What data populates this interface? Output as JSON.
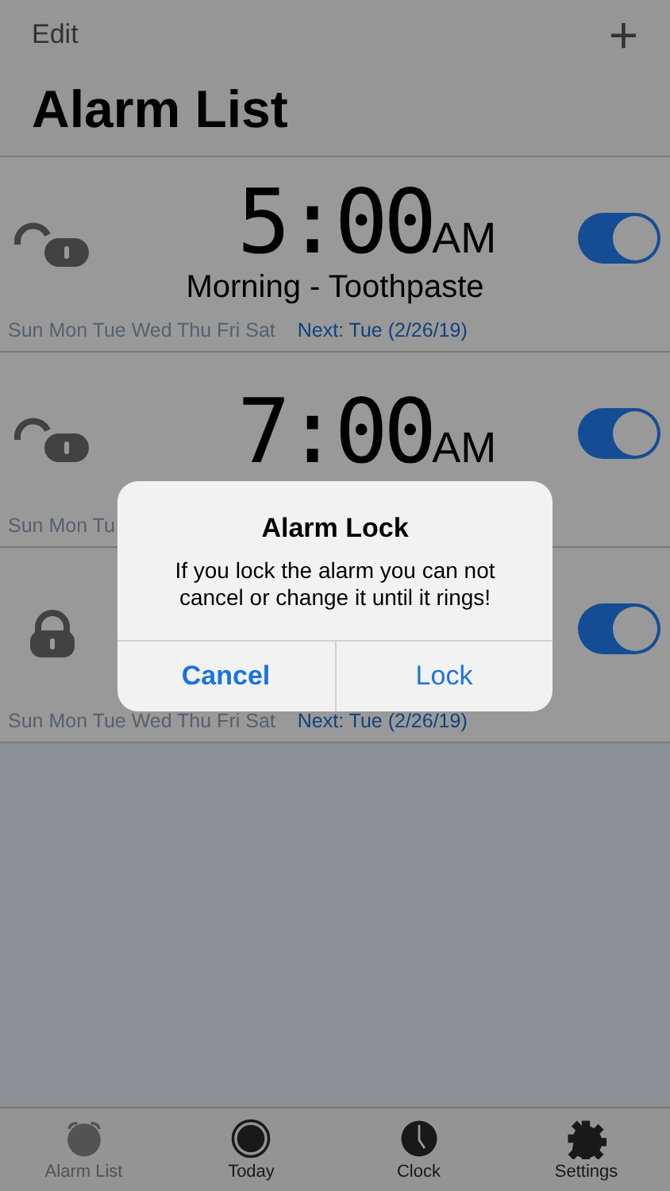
{
  "nav": {
    "edit": "Edit",
    "add": "+"
  },
  "title": "Alarm List",
  "alarms": [
    {
      "time": "5:00",
      "meridiem": "AM",
      "label": "Morning - Toothpaste",
      "days": "Sun Mon Tue Wed Thu Fri Sat",
      "next": "Next: Tue (2/26/19)",
      "locked": false,
      "on": true
    },
    {
      "time": "7:00",
      "meridiem": "AM",
      "days": "Sun Mon Tu",
      "locked": false,
      "on": true
    },
    {
      "days": "Sun Mon Tue Wed Thu Fri Sat",
      "next": "Next: Tue (2/26/19)",
      "locked": true,
      "on": true
    }
  ],
  "dialog": {
    "title": "Alarm Lock",
    "message": "If you lock the alarm you can not cancel or change it until it rings!",
    "buttons": [
      {
        "label": "Cancel",
        "kind": "cancel"
      },
      {
        "label": "Lock",
        "kind": "default"
      }
    ]
  },
  "tabs": [
    {
      "label": "Alarm List",
      "kind": "alarm",
      "selected": true
    },
    {
      "label": "Today",
      "kind": "today",
      "selected": false
    },
    {
      "label": "Clock",
      "kind": "clock",
      "selected": false
    },
    {
      "label": "Settings",
      "kind": "settings",
      "selected": false
    }
  ]
}
